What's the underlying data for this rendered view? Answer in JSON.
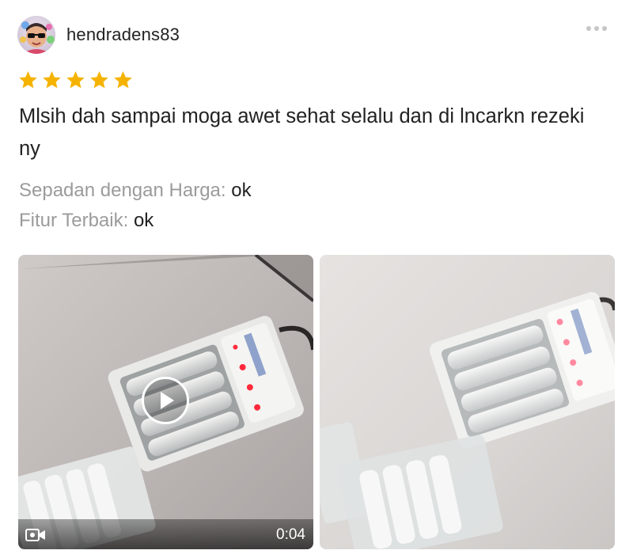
{
  "review": {
    "username": "hendradens83",
    "avatar_icon": "profile-photo-avatar",
    "more_icon": "more-options-icon",
    "rating": 5,
    "rating_max": 5,
    "star_color": "#f5b300",
    "comment": "Mlsih dah sampai moga awet sehat selalu dan di lncarkn rezeki ny",
    "attributes": [
      {
        "label": "Sepadan dengan Harga:",
        "value": "ok"
      },
      {
        "label": "Fitur Terbaik:",
        "value": "ok"
      }
    ]
  },
  "media": [
    {
      "kind": "video",
      "icon": "video-camera-icon",
      "play_icon": "play-icon",
      "duration": "0:04"
    },
    {
      "kind": "image"
    }
  ]
}
